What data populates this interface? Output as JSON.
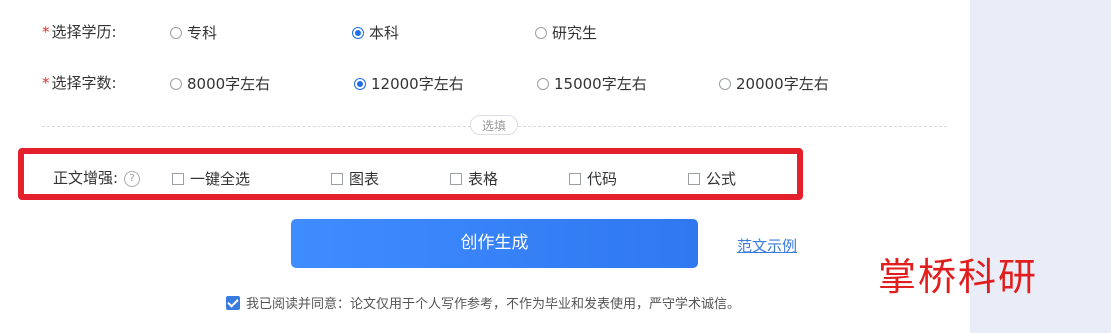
{
  "education": {
    "label": "选择学历:",
    "required_mark": "*",
    "options": [
      {
        "label": "专科",
        "checked": false
      },
      {
        "label": "本科",
        "checked": true
      },
      {
        "label": "研究生",
        "checked": false
      }
    ]
  },
  "word_count": {
    "label": "选择字数:",
    "required_mark": "*",
    "options": [
      {
        "label": "8000字左右",
        "checked": false
      },
      {
        "label": "12000字左右",
        "checked": true
      },
      {
        "label": "15000字左右",
        "checked": false
      },
      {
        "label": "20000字左右",
        "checked": false
      }
    ]
  },
  "divider_label": "选填",
  "enhance": {
    "label": "正文增强:",
    "help_icon": "question-mark-icon",
    "options": [
      {
        "label": "一键全选",
        "checked": false
      },
      {
        "label": "图表",
        "checked": false
      },
      {
        "label": "表格",
        "checked": false
      },
      {
        "label": "代码",
        "checked": false
      },
      {
        "label": "公式",
        "checked": false
      }
    ]
  },
  "create_button": "创作生成",
  "example_link": "范文示例",
  "watermark": "掌桥科研",
  "agreement": {
    "checked": true,
    "text": "我已阅读并同意：论文仅用于个人写作参考，不作为毕业和发表使用，严守学术诚信。"
  },
  "colors": {
    "accent": "#3a7be0",
    "highlight_border": "#e3202b",
    "required": "#e5322d"
  }
}
